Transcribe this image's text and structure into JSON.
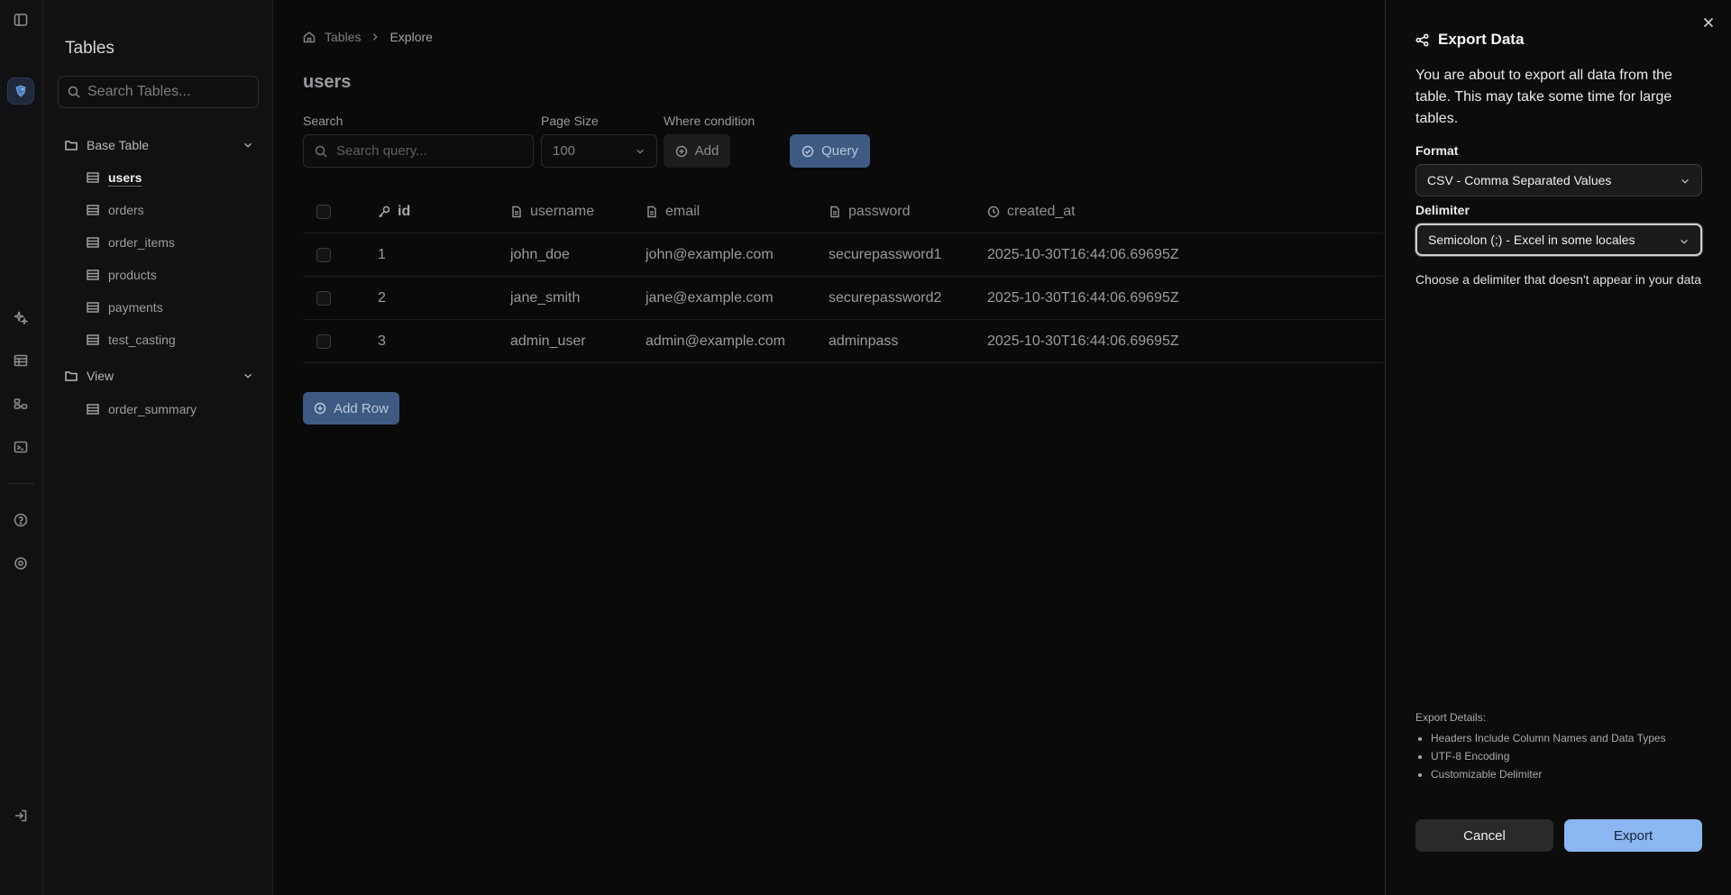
{
  "sidebar": {
    "title": "Tables",
    "search_placeholder": "Search Tables...",
    "groups": [
      {
        "label": "Base Table",
        "items": [
          "users",
          "orders",
          "order_items",
          "products",
          "payments",
          "test_casting"
        ]
      },
      {
        "label": "View",
        "items": [
          "order_summary"
        ]
      }
    ],
    "active_item": "users"
  },
  "breadcrumb": {
    "root": "Tables",
    "current": "Explore"
  },
  "main": {
    "title": "users",
    "search_label": "Search",
    "search_placeholder": "Search query...",
    "page_size_label": "Page Size",
    "page_size_value": "100",
    "where_label": "Where condition",
    "add_label": "Add",
    "query_label": "Query",
    "add_row_label": "Add Row"
  },
  "table": {
    "columns": [
      {
        "name": "id",
        "icon": "key-icon"
      },
      {
        "name": "username",
        "icon": "file-text-icon"
      },
      {
        "name": "email",
        "icon": "file-text-icon"
      },
      {
        "name": "password",
        "icon": "file-text-icon"
      },
      {
        "name": "created_at",
        "icon": "clock-icon"
      }
    ],
    "rows": [
      [
        "1",
        "john_doe",
        "john@example.com",
        "securepassword1",
        "2025-10-30T16:44:06.69695Z"
      ],
      [
        "2",
        "jane_smith",
        "jane@example.com",
        "securepassword2",
        "2025-10-30T16:44:06.69695Z"
      ],
      [
        "3",
        "admin_user",
        "admin@example.com",
        "adminpass",
        "2025-10-30T16:44:06.69695Z"
      ]
    ]
  },
  "export": {
    "title": "Export Data",
    "description": "You are about to export all data from the table. This may take some time for large tables.",
    "format_label": "Format",
    "format_value": "CSV - Comma Separated Values",
    "delimiter_label": "Delimiter",
    "delimiter_value": "Semicolon (;) - Excel in some locales",
    "delimiter_hint": "Choose a delimiter that doesn't appear in your data",
    "details_title": "Export Details:",
    "details": [
      "Headers Include Column Names and Data Types",
      "UTF-8 Encoding",
      "Customizable Delimiter"
    ],
    "cancel_label": "Cancel",
    "export_label": "Export"
  },
  "colors": {
    "accent": "#8cb6f2",
    "muted_button": "#3e5a82",
    "background": "#0a0a0a"
  }
}
